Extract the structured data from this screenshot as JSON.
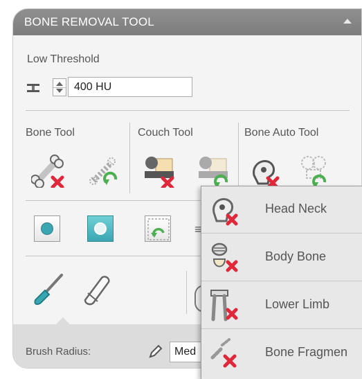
{
  "panel": {
    "title": "BONE REMOVAL TOOL",
    "low_threshold_label": "Low Threshold",
    "threshold_value": "400 HU"
  },
  "tool_groups": [
    {
      "label": "Bone Tool"
    },
    {
      "label": "Couch Tool"
    },
    {
      "label": "Bone Auto Tool"
    }
  ],
  "brush": {
    "radius_label": "Brush Radius:",
    "radius_value": "Med"
  },
  "popup_menu": {
    "items": [
      {
        "label": "Head Neck",
        "icon": "head-neck-remove-icon"
      },
      {
        "label": "Body Bone",
        "icon": "body-bone-remove-icon"
      },
      {
        "label": "Lower Limb",
        "icon": "lower-limb-remove-icon"
      },
      {
        "label": "Bone Fragmen",
        "icon": "bone-fragment-remove-icon"
      }
    ]
  },
  "colors": {
    "titlebar": "#888888",
    "accent_teal": "#3aa6b1",
    "remove_red": "#e0283a",
    "undo_green": "#4caf50"
  }
}
